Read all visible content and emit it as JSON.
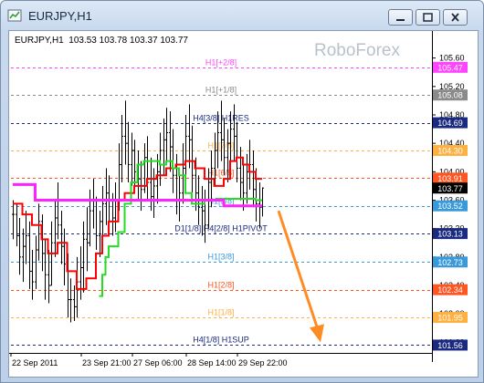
{
  "window": {
    "title": "EURJPY,H1",
    "icon": "chart-window-icon",
    "controls": [
      "minimize-icon",
      "maximize-icon",
      "close-icon"
    ]
  },
  "header": {
    "symbol_line": "EURJPY,H1  103.53 103.78 103.37 103.77"
  },
  "watermark": "RoboForex",
  "chart_data": {
    "type": "candlestick",
    "symbol": "EURJPY",
    "timeframe": "H1",
    "ohlc": {
      "open": 103.53,
      "high": 103.78,
      "low": 103.37,
      "close": 103.77
    },
    "ylim": [
      101.45,
      105.75
    ],
    "y_ticks": [
      "105.60",
      "105.20",
      "104.80",
      "104.40",
      "104.00",
      "103.60",
      "103.20",
      "102.80",
      "102.40",
      "102.00",
      "101.60"
    ],
    "x_ticks": [
      "22 Sep 2011",
      "23 Sep 21:00",
      "27 Sep 06:00",
      "28 Sep 14:00",
      "29 Sep 22:00"
    ],
    "levels": [
      {
        "name": "H1[+2/8]",
        "price": 105.47,
        "label": "105.47",
        "color": "#ff44ff"
      },
      {
        "name": "H1[+1/8]",
        "price": 105.08,
        "label": "105.08",
        "color": "#8a8a8a"
      },
      {
        "name": "H4[3/8] H1RES",
        "price": 104.69,
        "label": "104.69",
        "color": "#1a2a80"
      },
      {
        "name": "H1[7/8]",
        "price": 104.3,
        "label": "104.30",
        "color": "#ffb040"
      },
      {
        "name": "H1[6/8]",
        "price": 103.91,
        "label": "103.91",
        "color": "#ff5522"
      },
      {
        "name": "H1[5/8]",
        "price": 103.52,
        "label": "103.52",
        "color": "#3a9ad9"
      },
      {
        "name": "D1[1/8] H4[2/8] H1PIVOT",
        "price": 103.13,
        "label": "103.13",
        "color": "#1a2a80"
      },
      {
        "name": "H1[3/8]",
        "price": 102.73,
        "label": "102.73",
        "color": "#3a9ad9"
      },
      {
        "name": "H1[2/8]",
        "price": 102.34,
        "label": "102.34",
        "color": "#ff5522"
      },
      {
        "name": "H1[1/8]",
        "price": 101.95,
        "label": "101.95",
        "color": "#ffb040"
      },
      {
        "name": "H4[1/8] H1SUP",
        "price": 101.56,
        "label": "101.56",
        "color": "#1a2a80"
      }
    ],
    "current_price": {
      "value": 103.77,
      "label": "103.77"
    },
    "bars": [
      {
        "h": 103.6,
        "l": 103.05,
        "c": 103.4
      },
      {
        "h": 103.55,
        "l": 102.95,
        "c": 103.1
      },
      {
        "h": 103.35,
        "l": 102.55,
        "c": 102.8
      },
      {
        "h": 103.2,
        "l": 102.45,
        "c": 102.95
      },
      {
        "h": 103.45,
        "l": 102.7,
        "c": 103.1
      },
      {
        "h": 103.3,
        "l": 102.35,
        "c": 102.6
      },
      {
        "h": 102.9,
        "l": 102.2,
        "c": 102.45
      },
      {
        "h": 103.1,
        "l": 102.35,
        "c": 102.9
      },
      {
        "h": 103.55,
        "l": 102.75,
        "c": 103.3
      },
      {
        "h": 103.4,
        "l": 102.6,
        "c": 102.85
      },
      {
        "h": 103.05,
        "l": 102.2,
        "c": 102.55
      },
      {
        "h": 102.9,
        "l": 102.15,
        "c": 102.4
      },
      {
        "h": 103.3,
        "l": 102.4,
        "c": 103.0
      },
      {
        "h": 103.6,
        "l": 102.8,
        "c": 103.35
      },
      {
        "h": 103.85,
        "l": 103.05,
        "c": 103.25
      },
      {
        "h": 103.45,
        "l": 102.7,
        "c": 102.95
      },
      {
        "h": 103.2,
        "l": 102.4,
        "c": 102.7
      },
      {
        "h": 102.85,
        "l": 101.95,
        "c": 102.2
      },
      {
        "h": 102.5,
        "l": 101.88,
        "c": 102.2
      },
      {
        "h": 102.4,
        "l": 101.9,
        "c": 102.1
      },
      {
        "h": 102.8,
        "l": 101.95,
        "c": 102.45
      },
      {
        "h": 102.95,
        "l": 102.2,
        "c": 102.65
      },
      {
        "h": 103.3,
        "l": 102.3,
        "c": 103.05
      },
      {
        "h": 103.5,
        "l": 102.6,
        "c": 103.0
      },
      {
        "h": 103.75,
        "l": 102.95,
        "c": 103.45
      },
      {
        "h": 103.9,
        "l": 103.2,
        "c": 103.6
      },
      {
        "h": 103.65,
        "l": 102.9,
        "c": 103.1
      },
      {
        "h": 103.45,
        "l": 102.8,
        "c": 103.3
      },
      {
        "h": 103.8,
        "l": 103.05,
        "c": 103.55
      },
      {
        "h": 104.05,
        "l": 103.25,
        "c": 103.7
      },
      {
        "h": 103.95,
        "l": 103.3,
        "c": 103.6
      },
      {
        "h": 103.7,
        "l": 103.1,
        "c": 103.35
      },
      {
        "h": 103.85,
        "l": 103.15,
        "c": 103.6
      },
      {
        "h": 104.4,
        "l": 103.45,
        "c": 104.1
      },
      {
        "h": 104.8,
        "l": 103.85,
        "c": 104.5
      },
      {
        "h": 105.0,
        "l": 104.1,
        "c": 104.4
      },
      {
        "h": 104.7,
        "l": 103.85,
        "c": 104.1
      },
      {
        "h": 104.55,
        "l": 103.8,
        "c": 104.3
      },
      {
        "h": 104.45,
        "l": 103.75,
        "c": 104.0
      },
      {
        "h": 104.3,
        "l": 103.6,
        "c": 103.9
      },
      {
        "h": 104.15,
        "l": 103.45,
        "c": 103.75
      },
      {
        "h": 104.4,
        "l": 103.7,
        "c": 104.2
      },
      {
        "h": 104.5,
        "l": 103.6,
        "c": 103.85
      },
      {
        "h": 104.2,
        "l": 103.45,
        "c": 103.65
      },
      {
        "h": 104.05,
        "l": 103.35,
        "c": 103.8
      },
      {
        "h": 104.25,
        "l": 103.55,
        "c": 104.0
      },
      {
        "h": 104.55,
        "l": 103.8,
        "c": 104.3
      },
      {
        "h": 104.75,
        "l": 103.95,
        "c": 104.45
      },
      {
        "h": 104.9,
        "l": 104.1,
        "c": 104.55
      },
      {
        "h": 104.85,
        "l": 104.0,
        "c": 104.35
      },
      {
        "h": 104.6,
        "l": 103.7,
        "c": 103.95
      },
      {
        "h": 104.25,
        "l": 103.4,
        "c": 103.6
      },
      {
        "h": 103.95,
        "l": 103.3,
        "c": 103.7
      },
      {
        "h": 104.4,
        "l": 103.55,
        "c": 104.05
      },
      {
        "h": 104.8,
        "l": 103.85,
        "c": 104.5
      },
      {
        "h": 104.95,
        "l": 104.05,
        "c": 104.45
      },
      {
        "h": 104.65,
        "l": 103.7,
        "c": 103.95
      },
      {
        "h": 104.2,
        "l": 103.45,
        "c": 103.7
      },
      {
        "h": 103.95,
        "l": 103.25,
        "c": 103.5
      },
      {
        "h": 103.8,
        "l": 103.1,
        "c": 103.45
      },
      {
        "h": 103.75,
        "l": 103.0,
        "c": 103.25
      },
      {
        "h": 104.05,
        "l": 103.2,
        "c": 103.85
      },
      {
        "h": 104.3,
        "l": 103.5,
        "c": 104.05
      },
      {
        "h": 104.55,
        "l": 103.8,
        "c": 104.3
      },
      {
        "h": 104.85,
        "l": 104.05,
        "c": 104.55
      },
      {
        "h": 105.0,
        "l": 104.15,
        "c": 104.45
      },
      {
        "h": 104.75,
        "l": 103.95,
        "c": 104.2
      },
      {
        "h": 104.6,
        "l": 103.85,
        "c": 104.4
      },
      {
        "h": 104.85,
        "l": 104.1,
        "c": 104.6
      },
      {
        "h": 104.95,
        "l": 104.15,
        "c": 104.5
      },
      {
        "h": 104.7,
        "l": 103.85,
        "c": 104.05
      },
      {
        "h": 104.35,
        "l": 103.6,
        "c": 103.85
      },
      {
        "h": 104.1,
        "l": 103.45,
        "c": 103.7
      },
      {
        "h": 104.25,
        "l": 103.55,
        "c": 104.0
      },
      {
        "h": 104.45,
        "l": 103.75,
        "c": 104.1
      },
      {
        "h": 104.3,
        "l": 103.5,
        "c": 103.75
      },
      {
        "h": 104.05,
        "l": 103.3,
        "c": 103.55
      },
      {
        "h": 103.85,
        "l": 103.2,
        "c": 103.5
      },
      {
        "h": 103.78,
        "l": 103.37,
        "c": 103.77
      }
    ],
    "stepline_upper": {
      "color": "#ff22ff",
      "points": [
        [
          0,
          103.82
        ],
        [
          7,
          103.82
        ],
        [
          7,
          103.6
        ],
        [
          20,
          103.6
        ],
        [
          31,
          103.6
        ],
        [
          41,
          103.6
        ],
        [
          55,
          103.6
        ],
        [
          66,
          103.52
        ],
        [
          78,
          103.52
        ]
      ]
    },
    "stepline_lower": {
      "color": "#ff0000",
      "points": [
        [
          0,
          103.55
        ],
        [
          3,
          103.4
        ],
        [
          6,
          103.25
        ],
        [
          9,
          103.05
        ],
        [
          11,
          102.85
        ],
        [
          14,
          103.0
        ],
        [
          17,
          102.6
        ],
        [
          20,
          102.35
        ],
        [
          23,
          102.5
        ],
        [
          26,
          102.85
        ],
        [
          28,
          103.1
        ],
        [
          30,
          103.3
        ],
        [
          33,
          103.6
        ],
        [
          35,
          103.7
        ],
        [
          38,
          103.8
        ],
        [
          42,
          103.9
        ],
        [
          45,
          103.95
        ],
        [
          48,
          104.05
        ],
        [
          51,
          104.1
        ],
        [
          54,
          104.15
        ],
        [
          57,
          104.05
        ],
        [
          60,
          103.9
        ],
        [
          63,
          103.8
        ],
        [
          66,
          103.9
        ],
        [
          68,
          104.15
        ],
        [
          70,
          104.2
        ],
        [
          72,
          104.1
        ],
        [
          74,
          104.0
        ],
        [
          76,
          103.9
        ],
        [
          78,
          103.9
        ]
      ]
    },
    "stepline_green": {
      "color": "#22dd22",
      "points": [
        [
          27,
          102.25
        ],
        [
          28,
          102.55
        ],
        [
          29,
          102.8
        ],
        [
          30,
          102.95
        ],
        [
          33,
          103.15
        ],
        [
          35,
          103.55
        ],
        [
          37,
          103.85
        ],
        [
          39,
          104.1
        ],
        [
          41,
          104.15
        ],
        [
          44,
          104.15
        ],
        [
          46,
          104.1
        ],
        [
          48,
          104.15
        ],
        [
          50,
          104.05
        ],
        [
          52,
          103.95
        ],
        [
          54,
          103.7
        ],
        [
          56,
          103.55
        ],
        [
          60,
          103.6
        ],
        [
          64,
          103.62
        ],
        [
          68,
          103.62
        ],
        [
          72,
          103.62
        ],
        [
          76,
          103.6
        ],
        [
          78,
          103.6
        ]
      ]
    },
    "forecast_arrow": {
      "from_bar": 78,
      "from_price": 103.45,
      "to_bar": 86,
      "to_price": 101.6,
      "color": "#ff8c22"
    }
  }
}
